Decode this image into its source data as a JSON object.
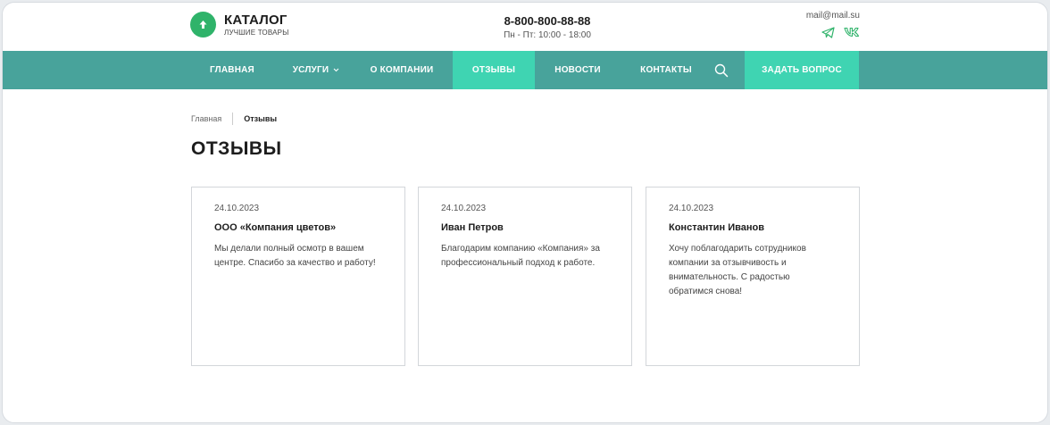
{
  "header": {
    "logo_title": "КАТАЛОГ",
    "logo_subtitle": "ЛУЧШИЕ ТОВАРЫ",
    "phone": "8-800-800-88-88",
    "hours": "Пн - Пт: 10:00 - 18:00",
    "email": "mail@mail.su",
    "social_icons": [
      "telegram-icon",
      "vk-icon"
    ],
    "brand_color": "#2fb36a"
  },
  "nav": {
    "items": [
      {
        "label": "ГЛАВНАЯ"
      },
      {
        "label": "УСЛУГИ",
        "has_dropdown": true
      },
      {
        "label": "О КОМПАНИИ"
      },
      {
        "label": "ОТЗЫВЫ",
        "active": true
      },
      {
        "label": "НОВОСТИ"
      },
      {
        "label": "КОНТАКТЫ"
      }
    ],
    "search_icon": "search-icon",
    "cta_label": "ЗАДАТЬ ВОПРОС",
    "bg_color": "#48a39b",
    "accent_color": "#3fd4b2"
  },
  "breadcrumb": {
    "home": "Главная",
    "current": "Отзывы"
  },
  "page": {
    "title": "ОТЗЫВЫ"
  },
  "reviews": [
    {
      "date": "24.10.2023",
      "name": "ООО «Компания цветов»",
      "text": "Мы делали полный осмотр в вашем центре. Спасибо за качество и работу!"
    },
    {
      "date": "24.10.2023",
      "name": "Иван Петров",
      "text": "Благодарим компанию «Компания» за профессиональный подход к работе."
    },
    {
      "date": "24.10.2023",
      "name": "Константин Иванов",
      "text": "Хочу поблагодарить сотрудников компании за отзывчивость и внимательность. С радостью обратимся снова!"
    }
  ]
}
